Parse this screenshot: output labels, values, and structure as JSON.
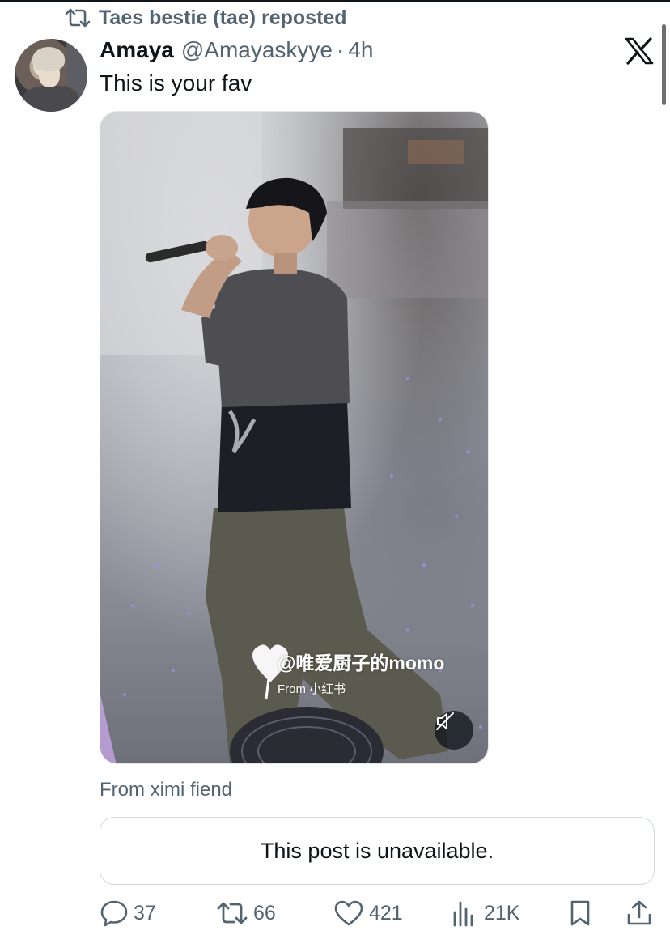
{
  "repost_banner": {
    "icon": "repost-icon",
    "text": "Taes bestie (tae) reposted"
  },
  "post": {
    "author_name": "Amaya",
    "author_handle": "@Amayaskyye",
    "separator": "·",
    "time": "4h",
    "text": "This is your fav",
    "avatar": "avatar-image"
  },
  "media": {
    "watermark_handle": "@唯爱厨子的momo",
    "watermark_source": "From 小红书",
    "mute_icon": "muted-speaker-icon"
  },
  "from_attribution": "From ximi fiend",
  "quoted_post": {
    "message": "This post is unavailable."
  },
  "actions": {
    "replies": "37",
    "reposts": "66",
    "likes": "421",
    "views": "21K",
    "bookmark_icon": "bookmark-icon",
    "share_icon": "share-icon"
  },
  "colors": {
    "text_primary": "#0f1419",
    "text_secondary": "#536471",
    "border": "#cfd9de"
  }
}
